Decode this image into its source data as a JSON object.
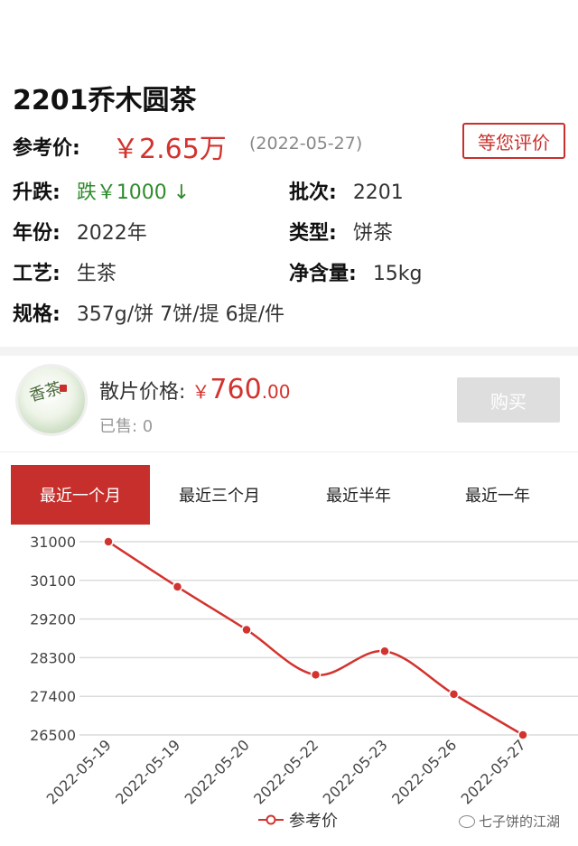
{
  "product": {
    "title": "2201乔木圆茶",
    "ref_price_label": "参考价:",
    "ref_price_value": "￥2.65万",
    "ref_price_date": "(2022-05-27)",
    "rate_button": "等您评价"
  },
  "attributes": {
    "change_label": "升跌:",
    "change_value": "跌￥1000 ↓",
    "batch_label": "批次:",
    "batch_value": "2201",
    "year_label": "年份:",
    "year_value": "2022年",
    "type_label": "类型:",
    "type_value": "饼茶",
    "craft_label": "工艺:",
    "craft_value": "生茶",
    "weight_label": "净含量:",
    "weight_value": "15kg",
    "spec_label": "规格:",
    "spec_value": "357g/饼 7饼/提 6提/件"
  },
  "loose": {
    "label": "散片价格:",
    "currency": "￥",
    "amount": "760",
    "decimals": ".00",
    "sold": "已售: 0",
    "buy_button": "购买"
  },
  "tabs": [
    "最近一个月",
    "最近三个月",
    "最近半年",
    "最近一年"
  ],
  "active_tab": 0,
  "legend_label": "参考价",
  "watermark": "七子饼的江湖",
  "colors": {
    "accent": "#c62f2b",
    "price": "#d2332e",
    "down": "#2e8b2e"
  },
  "chart_data": {
    "type": "line",
    "categories": [
      "2022-05-19",
      "2022-05-19",
      "2022-05-20",
      "2022-05-22",
      "2022-05-23",
      "2022-05-26",
      "2022-05-27"
    ],
    "series": [
      {
        "name": "参考价",
        "values": [
          31000,
          29950,
          28950,
          27900,
          28450,
          27450,
          26500
        ]
      }
    ],
    "yticks": [
      31000,
      30100,
      29200,
      28300,
      27400,
      26500
    ],
    "ylim": [
      26500,
      31000
    ],
    "grid": true,
    "legend": "bottom-center"
  }
}
